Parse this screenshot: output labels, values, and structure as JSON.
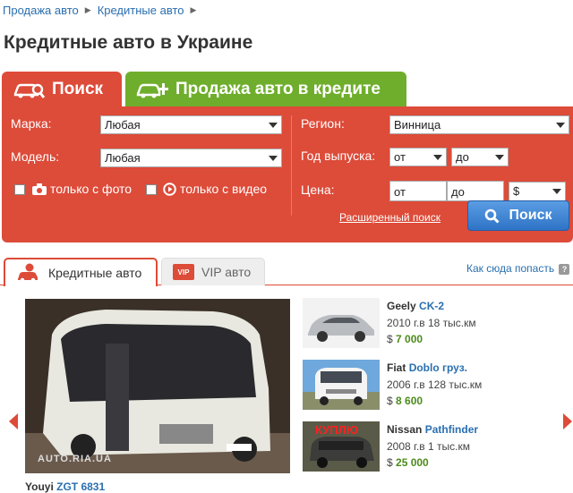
{
  "breadcrumbs": [
    "Продажа авто",
    "Кредитные авто"
  ],
  "page_title": "Кредитные авто в Украине",
  "tabs": {
    "search": "Поиск",
    "credit_sale": "Продажа авто в кредите"
  },
  "search_form": {
    "brand_label": "Марка:",
    "brand_value": "Любая",
    "model_label": "Модель:",
    "model_value": "Любая",
    "photo_label": "только с фото",
    "video_label": "только с видео",
    "region_label": "Регион:",
    "region_value": "Винница",
    "year_label": "Год выпуска:",
    "year_from": "от",
    "year_to": "до",
    "price_label": "Цена:",
    "price_from": "от",
    "price_to": "до",
    "currency": "$",
    "advanced_link": "Расширенный поиск",
    "search_button": "Поиск"
  },
  "listing_tabs": {
    "credit": "Кредитные авто",
    "vip": "VIP авто",
    "vip_badge": "VIP",
    "how_link": "Как сюда попасть"
  },
  "featured": {
    "brand": "Youyi",
    "model": "ZGT 6831",
    "watermark": "AUTO.RIA.UA"
  },
  "listings": [
    {
      "brand": "Geely",
      "model": "CK-2",
      "desc": "2010 г.в 18 тыс.км",
      "currency": "$",
      "price": "7 000"
    },
    {
      "brand": "Fiat",
      "model": "Doblo груз.",
      "desc": "2006 г.в 128 тыс.км",
      "currency": "$",
      "price": "8 600"
    },
    {
      "brand": "Nissan",
      "model": "Pathfinder",
      "desc": "2008 г.в 1 тыс.км",
      "currency": "$",
      "price": "25 000",
      "thumb_text": "КУПЛЮ"
    }
  ],
  "colors": {
    "accent_red": "#dd4b39",
    "accent_green": "#6fae2c",
    "link_blue": "#2a6fb0",
    "price_green": "#4c8b1a"
  }
}
